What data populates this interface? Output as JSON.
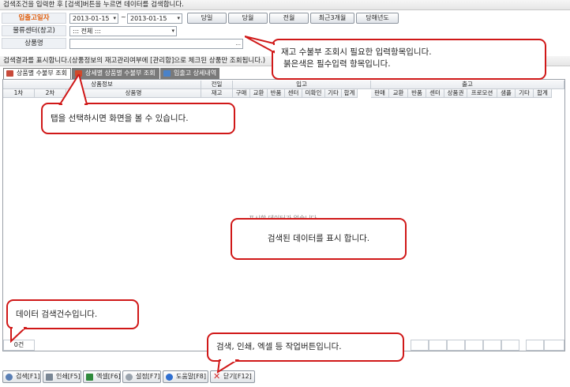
{
  "search_header": "검색조건을 입력한 후 [검색]버튼을 누르면 데이터를 검색합니다.",
  "form": {
    "date_label": "입출고일자",
    "date_from": "2013-01-15",
    "date_sep": "~",
    "date_to": "2013-01-15",
    "warehouse_label": "물류센터(창고)",
    "warehouse_value": "::: 전체 :::",
    "product_label": "상품명",
    "product_value": "",
    "product_ellipsis": "...",
    "quick_buttons": [
      "당일",
      "당월",
      "전월",
      "최근3개월",
      "당해년도"
    ]
  },
  "results_header": "검색결과를 표시합니다.(상품정보의 재고관리여부에 [관리함]으로 체크된 상품만 조회됩니다.)",
  "tabs": [
    {
      "label": "상품별 수불부 조회"
    },
    {
      "label": "상세별 상품별 수불부 조회"
    },
    {
      "label": "입출고 상세내역"
    }
  ],
  "table": {
    "group_headers": {
      "product_info": "상품정보",
      "prev_day": "전일",
      "inbound": "입고",
      "outbound": "출고"
    },
    "columns": {
      "cat1": "1차",
      "cat2": "2차",
      "product_name": "상품명",
      "stock": "재고",
      "in": [
        "구매",
        "교환",
        "반품",
        "센터",
        "미확인",
        "기타",
        "합계"
      ],
      "out": [
        "판매",
        "교환",
        "반품",
        "센터",
        "상품권",
        "프로모션",
        "샘플",
        "기타",
        "합계"
      ]
    },
    "empty_message": "표시할 데이터가 없습니다",
    "footer_count": "0건"
  },
  "callouts": {
    "input_help_line1": "재고 수불부 조회시 필요한 입력항목입니다.",
    "input_help_line2": "붉은색은 필수입력 항목입니다.",
    "tab_help": "탭을 선택하시면 화면을 볼 수 있습니다.",
    "data_help": "검색된 데이터를 표시 합니다.",
    "count_help": "데이터 검색건수입니다.",
    "buttons_help": "검색, 인쇄, 엑셀 등 작업버튼입니다."
  },
  "bottom_buttons": [
    {
      "label": "검색[F1]",
      "icon": "search-icon"
    },
    {
      "label": "인쇄[F5]",
      "icon": "printer-icon"
    },
    {
      "label": "엑셀[F6]",
      "icon": "excel-icon"
    },
    {
      "label": "설정[F7]",
      "icon": "gear-icon"
    },
    {
      "label": "도움말[F8]",
      "icon": "help-icon"
    },
    {
      "label": "닫기[F12]",
      "icon": "close-icon"
    }
  ]
}
